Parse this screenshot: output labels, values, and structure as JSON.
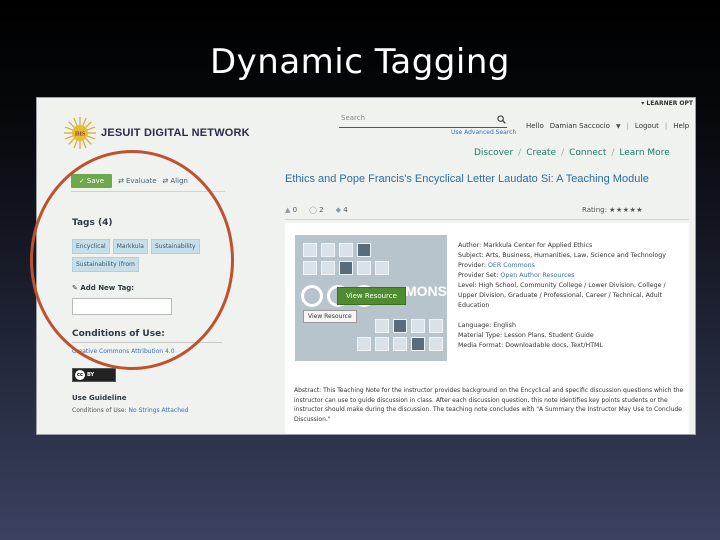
{
  "slide": {
    "title": "Dynamic Tagging"
  },
  "header": {
    "learner_options": "▾ LEARNER OPT",
    "logo_text": "JESUIT DIGITAL NETWORK",
    "search_placeholder": "Search",
    "advanced_search": "Use Advanced Search",
    "greeting": "Hello",
    "user_name": "Damian Saccocio",
    "logout": "Logout",
    "help": "Help",
    "nav": [
      "Discover",
      "Create",
      "Connect",
      "Learn More"
    ]
  },
  "actions": {
    "save": "Save",
    "evaluate": "Evaluate",
    "align": "Align"
  },
  "tags": {
    "title": "Tags (4)",
    "items": [
      "Encyclical",
      "Markkula",
      "Sustainability",
      "Sustainability (from"
    ],
    "add_label": "Add New Tag:"
  },
  "conditions": {
    "title": "Conditions of Use:",
    "license_link": "Creative Commons Attribution 4.0",
    "badge_cc": "cc",
    "badge_by": "BY",
    "use_title": "Use Guideline",
    "use_prefix": "Conditions of Use:",
    "use_link": "No Strings Attached"
  },
  "resource": {
    "title": "Ethics and Pope Francis's Encyclical Letter Laudato Si: A Teaching Module",
    "views": "0",
    "saves": "2",
    "likes": "4",
    "rating_label": "Rating:",
    "rating_stars": "★★★★★",
    "thumb_text": "MONS",
    "view_green": "View Resource",
    "view_white": "View Resource",
    "meta": {
      "author": "Author: Markkula Center for Applied Ethics",
      "subject": "Subject: Arts, Business, Humanities, Law, Science and Technology",
      "provider_label": "Provider:",
      "provider_value": "OER Commons",
      "provider_set_label": "Provider Set:",
      "provider_set_value": "Open Author Resources",
      "level": "Level: High School, Community College / Lower Division, College / Upper Division, Graduate / Professional, Career / Technical, Adult Education",
      "language": "Language: English",
      "material_type": "Material Type: Lesson Plans, Student Guide",
      "media_format": "Media Format: Downloadable docs, Text/HTML"
    },
    "abstract": "Abstract: This Teaching Note for the instructor provides background on the Encyclical and specific discussion questions which the instructor can use to guide discussion in class. After each discussion question, this note identifies key points students or the instructor should make during the discussion. The teaching note concludes with \"A Summary the Instructor May Use to Conclude Discussion.\""
  },
  "colors": {
    "ring": "#c0502e",
    "save_green": "#6ea84d",
    "nav_teal": "#1f7a6a",
    "link_blue": "#3a6fb0"
  }
}
